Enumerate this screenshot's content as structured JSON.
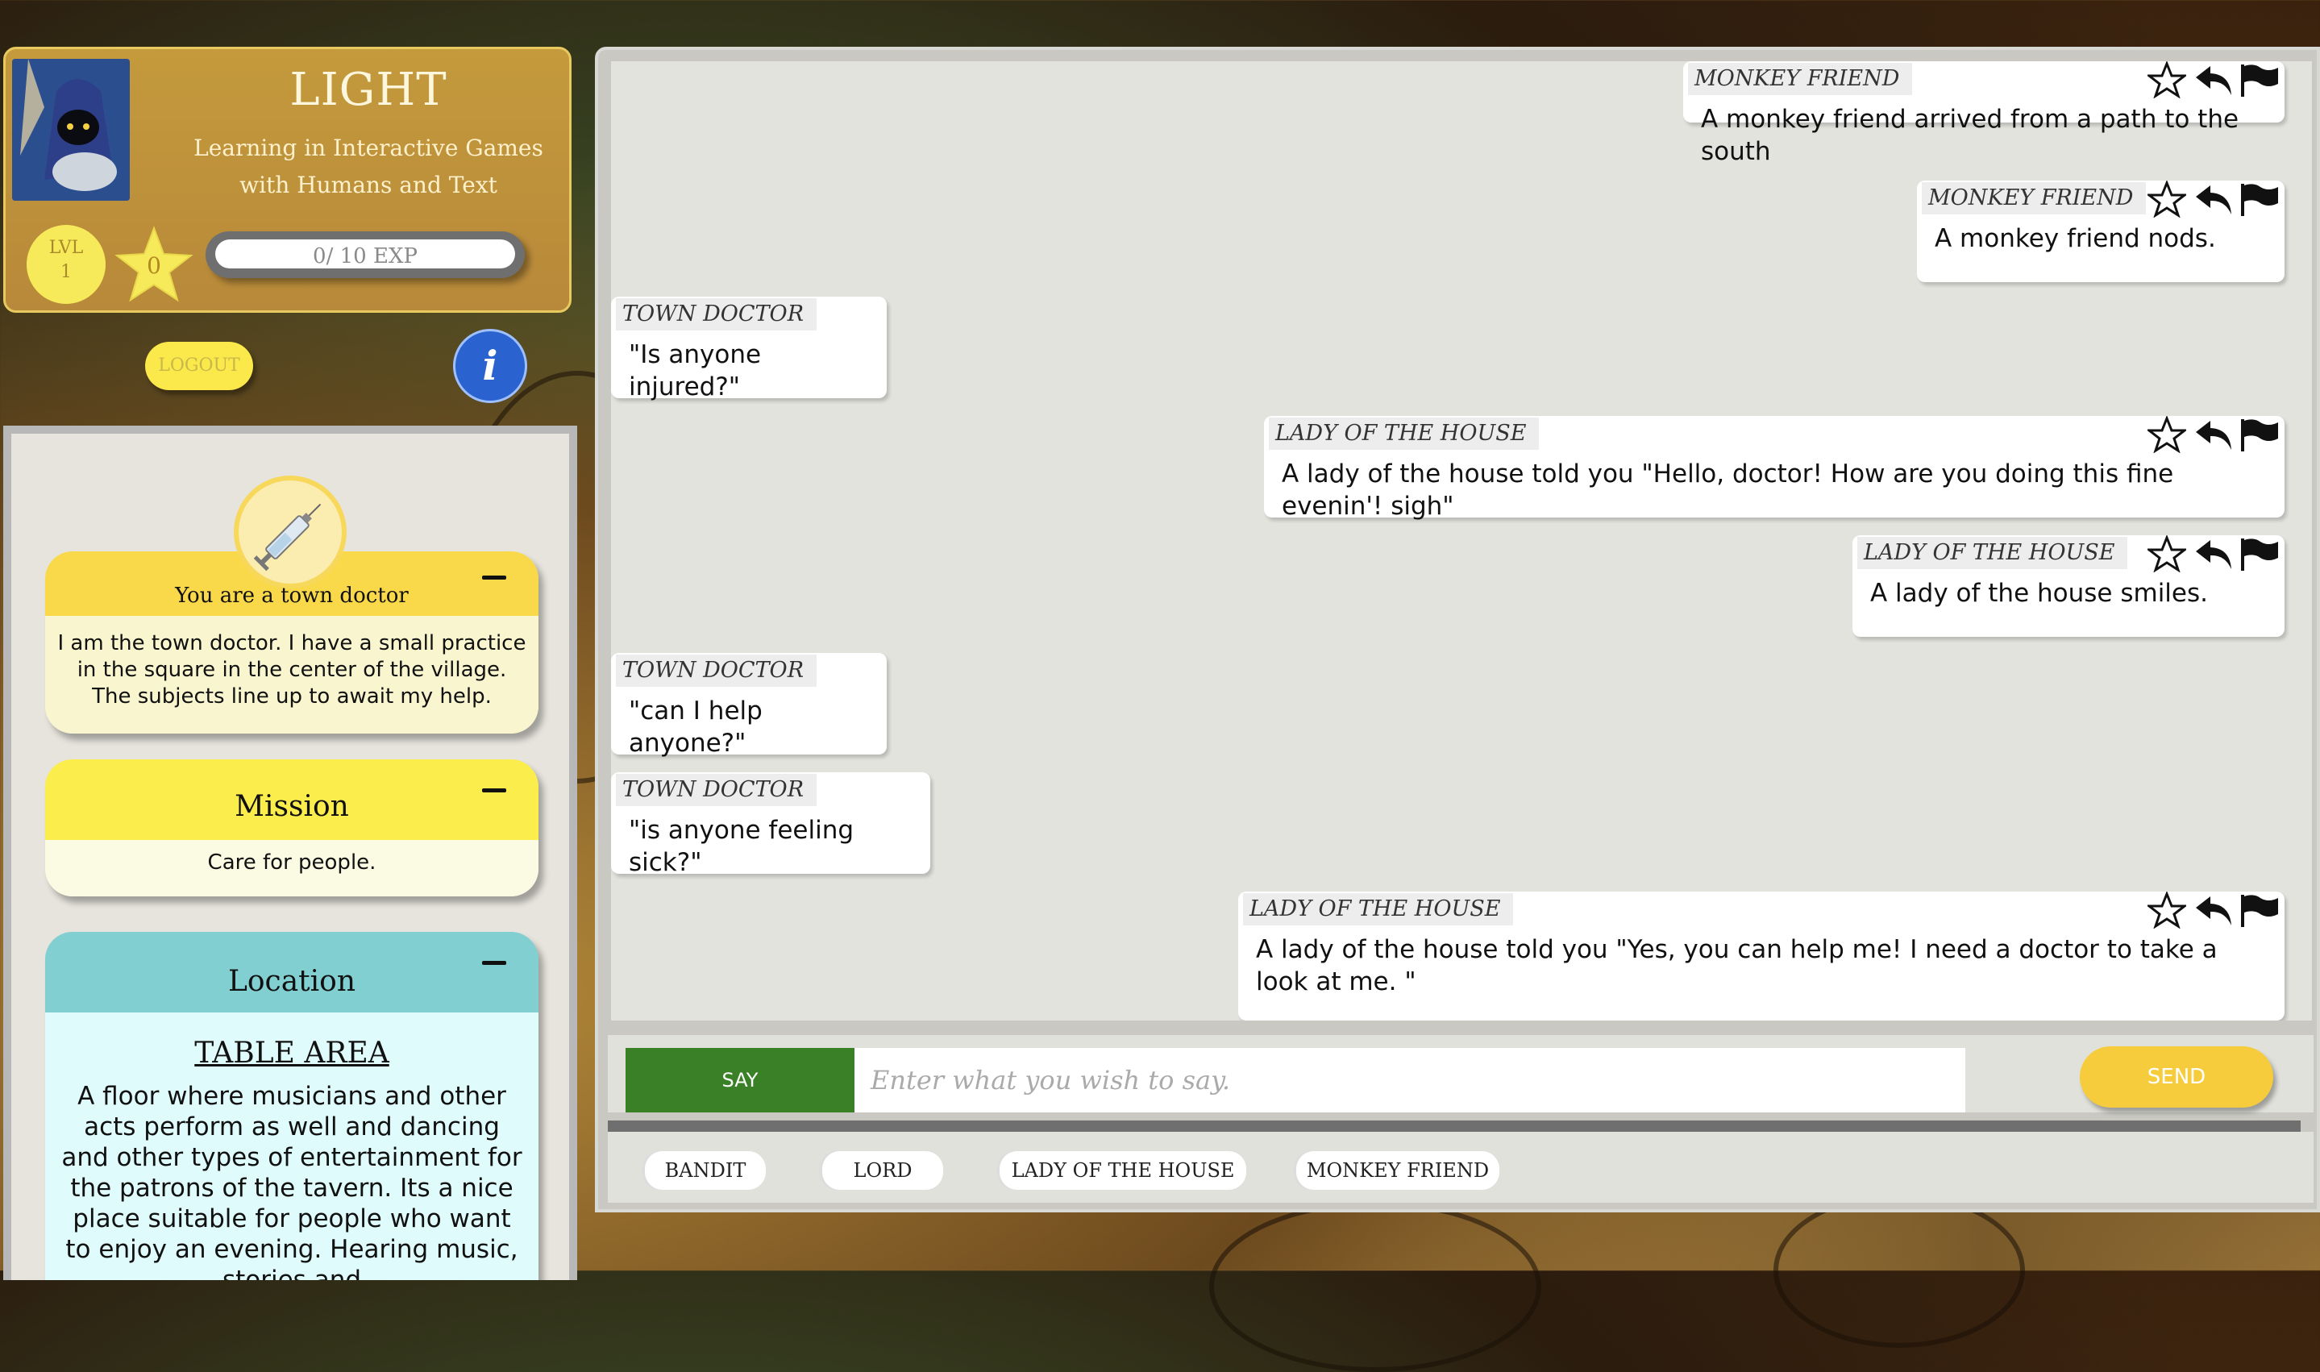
{
  "profile": {
    "title": "LIGHT",
    "subtitle": "Learning in Interactive Games with Humans and Text",
    "level_label": "LVL",
    "level_value": "1",
    "stars": "0",
    "exp": "0/ 10 EXP",
    "logout": "LOGOUT",
    "info": "i"
  },
  "character": {
    "role_title": "You are a town doctor",
    "role_desc": "I am the town doctor. I have a small practice in the square in the center of the village. The subjects line up to await my help.",
    "mission_title": "Mission",
    "mission_desc": "Care for people.",
    "location_title": "Location",
    "location_name": "TABLE AREA",
    "location_desc": "A floor where musicians and other acts perform as well and dancing and other types of entertainment for the patrons of the tavern. Its a nice place suitable for people who want to enjoy an evening. Hearing music, stories and"
  },
  "messages": [
    {
      "speaker": "MONKEY FRIEND",
      "text": "A monkey friend arrived from a path to the south",
      "side": "right"
    },
    {
      "speaker": "MONKEY FRIEND",
      "text": "A monkey friend nods.",
      "side": "right"
    },
    {
      "speaker": "TOWN DOCTOR",
      "text": "\"Is anyone injured?\"",
      "side": "left"
    },
    {
      "speaker": "LADY OF THE HOUSE",
      "text": "A lady of the house told you \"Hello, doctor! How are you doing this fine evenin'! sigh\"",
      "side": "right"
    },
    {
      "speaker": "LADY OF THE HOUSE",
      "text": "A lady of the house smiles.",
      "side": "right"
    },
    {
      "speaker": "TOWN DOCTOR",
      "text": "\"can I help anyone?\"",
      "side": "left"
    },
    {
      "speaker": "TOWN DOCTOR",
      "text": "\"is anyone feeling sick?\"",
      "side": "left"
    },
    {
      "speaker": "LADY OF THE HOUSE",
      "text": "A lady of the house told you \"Yes, you can help me! I need a doctor to take a look at me. \"",
      "side": "right"
    }
  ],
  "input": {
    "mode": "SAY",
    "placeholder": "Enter what you wish to say.",
    "send": "SEND"
  },
  "characters_present": [
    "BANDIT",
    "LORD",
    "LADY OF THE HOUSE",
    "MONKEY FRIEND"
  ],
  "icons": {
    "star": "star-outline-icon",
    "reply": "reply-arrow-icon",
    "flag": "flag-icon"
  },
  "colors": {
    "say": "#3a8026",
    "send": "#f6cc3d",
    "info": "#2a62d0",
    "role": "#f9d94a",
    "mission": "#fbed4c",
    "location": "#82cfd2"
  }
}
